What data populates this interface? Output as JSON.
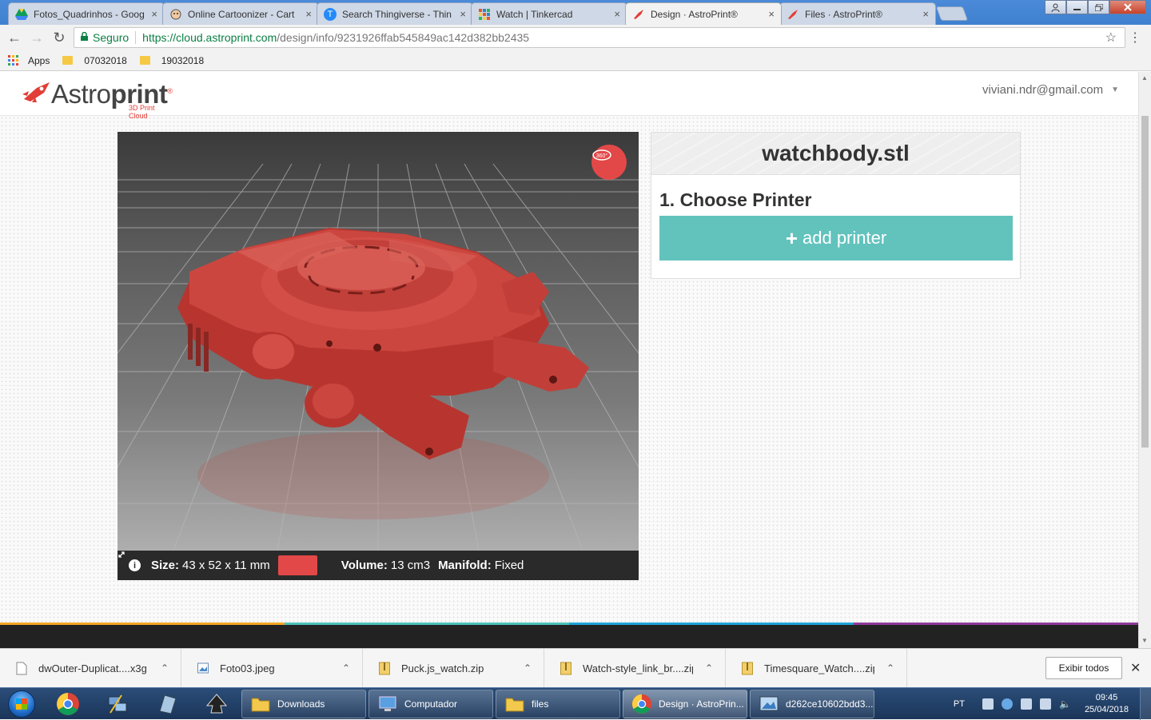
{
  "browser": {
    "tabs": [
      {
        "title": "Fotos_Quadrinhos - Goog",
        "icon": "google-drive-icon",
        "active": false
      },
      {
        "title": "Online Cartoonizer - Cart",
        "icon": "cartoon-face-icon",
        "active": false
      },
      {
        "title": "Search Thingiverse - Thin",
        "icon": "thingiverse-icon",
        "active": false
      },
      {
        "title": "Watch | Tinkercad",
        "icon": "tinkercad-icon",
        "active": false
      },
      {
        "title": "Design · AstroPrint®",
        "icon": "astroprint-rocket-icon",
        "active": true
      },
      {
        "title": "Files · AstroPrint®",
        "icon": "astroprint-rocket-icon",
        "active": false
      }
    ],
    "close_glyph": "×",
    "secure_label": "Seguro",
    "url_host": "https://cloud.astroprint.com",
    "url_path": "/design/info/9231926ffab545849ac142d382bb2435",
    "bookmarks": {
      "apps": "Apps",
      "folder1": "07032018",
      "folder2": "19032018"
    }
  },
  "site": {
    "logo_text_light": "Astro",
    "logo_text_bold": "print",
    "logo_reg": "®",
    "logo_subtitle": "3D Print Cloud",
    "user_email": "viviani.ndr@gmail.com",
    "btn_360_label": "360°"
  },
  "model": {
    "file_name": "watchbody.stl",
    "size_label": "Size:",
    "size_value": "43 x 52 x 11 mm",
    "volume_label": "Volume:",
    "volume_value": "13 cm3",
    "manifold_label": "Manifold:",
    "manifold_value": "Fixed",
    "model_color": "#c8403a"
  },
  "printer": {
    "step_title": "1. Choose Printer",
    "add_printer_label": "add printer",
    "button_color": "#62c3bd"
  },
  "colorbar": [
    "#f5a623",
    "#4cc2b8",
    "#1fa3d8",
    "#8e3a9b"
  ],
  "downloads": {
    "items": [
      {
        "name": "dwOuter-Duplicat....x3g",
        "icon": "file-icon"
      },
      {
        "name": "Foto03.jpeg",
        "icon": "image-file-icon"
      },
      {
        "name": "Puck.js_watch.zip",
        "icon": "zip-file-icon"
      },
      {
        "name": "Watch-style_link_br....zip",
        "icon": "zip-file-icon"
      },
      {
        "name": "Timesquare_Watch....zip",
        "icon": "zip-file-icon"
      }
    ],
    "show_all": "Exibir todos"
  },
  "taskbar": {
    "buttons": [
      {
        "label": "Downloads",
        "icon": "folder-icon"
      },
      {
        "label": "Computador",
        "icon": "computer-icon"
      },
      {
        "label": "files",
        "icon": "folder-icon"
      },
      {
        "label": "Design · AstroPrin...",
        "icon": "chrome-icon"
      },
      {
        "label": "d262ce10602bdd3...",
        "icon": "image-viewer-icon"
      }
    ],
    "lang": "PT",
    "time": "09:45",
    "date": "25/04/2018"
  }
}
